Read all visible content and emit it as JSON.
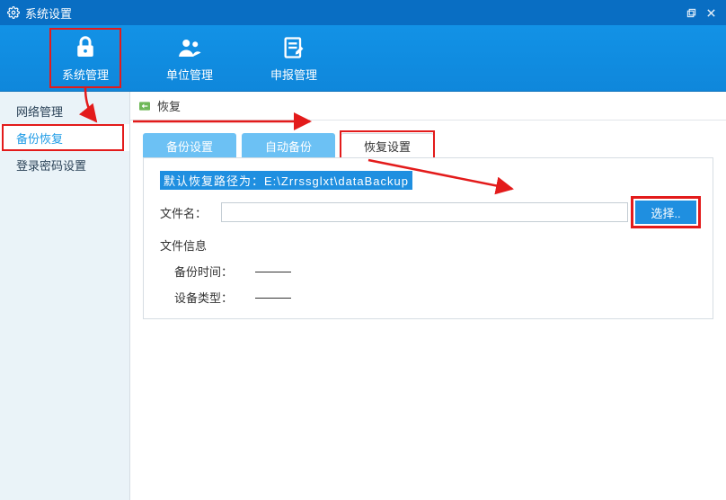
{
  "window": {
    "title": "系统设置",
    "restore_tooltip": "restore",
    "close_tooltip": "close"
  },
  "toolbar": {
    "items": [
      {
        "label": "系统管理",
        "selected": true
      },
      {
        "label": "单位管理",
        "selected": false
      },
      {
        "label": "申报管理",
        "selected": false
      }
    ]
  },
  "sidebar": {
    "items": [
      {
        "label": "网络管理",
        "selected": false
      },
      {
        "label": "备份恢复",
        "selected": true
      },
      {
        "label": "登录密码设置",
        "selected": false
      }
    ]
  },
  "page": {
    "title": "恢复"
  },
  "tabs": [
    {
      "label": "备份设置",
      "active": false
    },
    {
      "label": "自动备份",
      "active": false
    },
    {
      "label": "恢复设置",
      "active": true
    }
  ],
  "restore": {
    "default_path_notice": "默认恢复路径为：E:\\Zrrssglxt\\dataBackup",
    "file_name_label": "文件名：",
    "file_name_value": "",
    "choose_button": "选择..",
    "file_info_label": "文件信息",
    "backup_time_label": "备份时间：",
    "backup_time_value": "",
    "device_type_label": "设备类型：",
    "device_type_value": ""
  },
  "colors": {
    "header_blue": "#096ec3",
    "toolbar_blue": "#1292e6",
    "tab_blue": "#6cc1f4",
    "accent_blue": "#1f8fe0",
    "annotation_red": "#e31b1b"
  }
}
